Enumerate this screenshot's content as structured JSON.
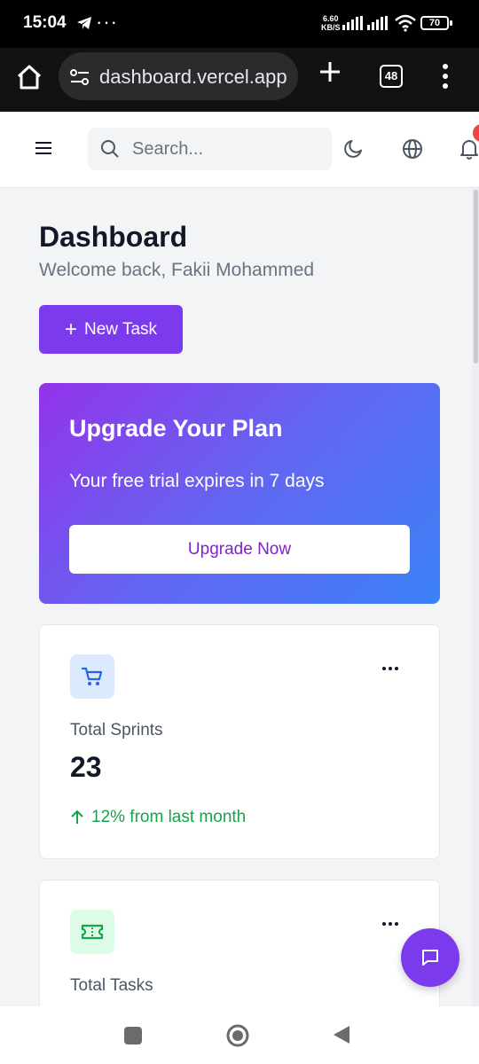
{
  "status_bar": {
    "time": "15:04",
    "more_indicator": "···",
    "net_speed_value": "6.60",
    "net_speed_unit": "KB/S",
    "battery": "70"
  },
  "browser": {
    "url": "dashboard.vercel.app",
    "tab_count": "48"
  },
  "header": {
    "search_placeholder": "Search...",
    "icons": [
      "menu-icon",
      "search-icon",
      "moon-icon",
      "globe-icon",
      "bell-icon"
    ]
  },
  "page": {
    "title": "Dashboard",
    "subtitle": "Welcome back, Fakii Mohammed",
    "new_task_label": "New Task"
  },
  "upgrade_card": {
    "heading": "Upgrade Your Plan",
    "description": "Your free trial expires in 7 days",
    "button_label": "Upgrade Now"
  },
  "stats": [
    {
      "label": "Total Sprints",
      "value": "23",
      "trend": "12% from last month",
      "icon": "cart-icon"
    },
    {
      "label": "Total Tasks",
      "icon": "ticket-icon"
    }
  ],
  "colors": {
    "accent": "#7c3aed",
    "gradient_start": "#9333ea",
    "gradient_end": "#3b82f6",
    "trend_up": "#16a34a",
    "notification": "#ef4444"
  }
}
